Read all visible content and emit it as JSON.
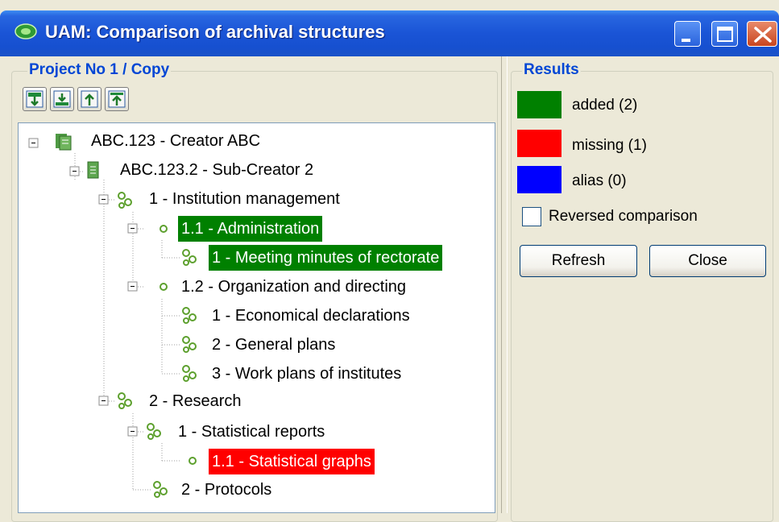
{
  "window": {
    "title": "UAM: Comparison of archival structures"
  },
  "left_panel": {
    "group_title": "Project No 1 / Copy",
    "toolbar": [
      {
        "icon": "expand-all-icon"
      },
      {
        "icon": "collapse-all-icon"
      },
      {
        "icon": "move-up-icon"
      },
      {
        "icon": "move-top-icon"
      }
    ]
  },
  "tree": {
    "nodes": [
      {
        "label": "ABC.123 - Creator ABC",
        "icon": "creator-icon",
        "state": "normal"
      },
      {
        "label": "ABC.123.2 - Sub-Creator 2",
        "icon": "subcreator-icon",
        "state": "normal"
      },
      {
        "label": "1 - Institution management",
        "icon": "gears-icon",
        "state": "normal"
      },
      {
        "label": "1.1 - Administration",
        "icon": "gear-small-icon",
        "state": "added"
      },
      {
        "label": "1 - Meeting minutes of rectorate",
        "icon": "gears-icon",
        "state": "added"
      },
      {
        "label": "1.2 - Organization and directing",
        "icon": "gear-small-icon",
        "state": "normal"
      },
      {
        "label": "1 - Economical declarations",
        "icon": "gears-icon",
        "state": "normal"
      },
      {
        "label": "2 - General plans",
        "icon": "gears-icon",
        "state": "normal"
      },
      {
        "label": "3 - Work plans of institutes",
        "icon": "gears-icon",
        "state": "normal"
      },
      {
        "label": "2 - Research",
        "icon": "gears-icon",
        "state": "normal"
      },
      {
        "label": "1 - Statistical reports",
        "icon": "gears-icon",
        "state": "normal"
      },
      {
        "label": "1.1 - Statistical graphs",
        "icon": "gear-small-icon",
        "state": "missing"
      },
      {
        "label": "2 - Protocols",
        "icon": "gears-icon",
        "state": "normal"
      }
    ]
  },
  "results": {
    "group_title": "Results",
    "legend": [
      {
        "label": "added (2)",
        "color": "#008000"
      },
      {
        "label": "missing (1)",
        "color": "#ff0000"
      },
      {
        "label": "alias (0)",
        "color": "#0000ff"
      }
    ],
    "reversed_label": "Reversed comparison",
    "reversed_checked": false,
    "refresh_label": "Refresh",
    "close_label": "Close"
  }
}
